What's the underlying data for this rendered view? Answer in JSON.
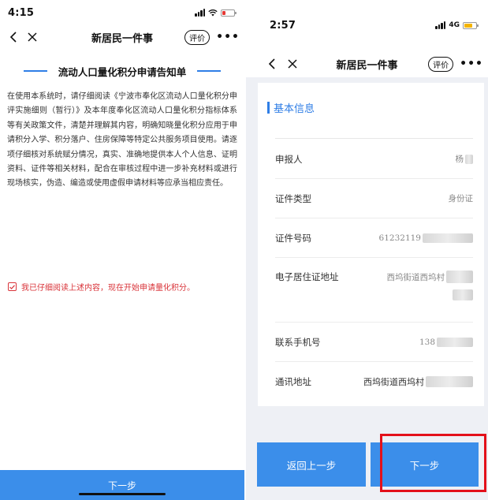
{
  "left": {
    "status": {
      "time": "4:15"
    },
    "nav": {
      "title": "新居民一件事",
      "rate": "评价",
      "more": "•••"
    },
    "notice": {
      "title": "流动人口量化积分申请告知单",
      "body": "在使用本系统时，请仔细阅读《宁波市奉化区流动人口量化积分申评实施细则（暂行）》及本年度奉化区流动人口量化积分指标体系等有关政策文件，清楚并理解其内容，明确知晓量化积分应用于申请积分入学、积分落户、住房保障等特定公共服务项目使用。请逐项仔细核对系统赋分情况，真实、准确地提供本人个人信息、证明资料、证件等相关材料，配合在审核过程中进一步补充材料或进行现场核实，伪造、编造或使用虚假申请材料等应承当相应责任。"
    },
    "agree": {
      "text": "我已仔细阅读上述内容，现在开始申请量化积分。"
    },
    "next_button": "下一步"
  },
  "right": {
    "status": {
      "time": "2:57",
      "network": "4G"
    },
    "nav": {
      "title": "新居民一件事",
      "rate": "评价",
      "more": "•••"
    },
    "section_title": "基本信息",
    "rows": [
      {
        "label": "申报人",
        "value": "杨"
      },
      {
        "label": "证件类型",
        "value": "身份证"
      },
      {
        "label": "证件号码",
        "value": "61232119"
      },
      {
        "label": "电子居住证地址",
        "value": "西坞街道西坞村"
      },
      {
        "label": "联系手机号",
        "value": "138"
      },
      {
        "label": "通讯地址",
        "value": "西坞街道西坞村"
      }
    ],
    "back_button": "返回上一步",
    "next_button": "下一步",
    "highlight_color": "#e3101a"
  },
  "colors": {
    "accent": "#3b8eea",
    "title_blue": "#2f7ee6",
    "agree_red": "#d9343a"
  }
}
